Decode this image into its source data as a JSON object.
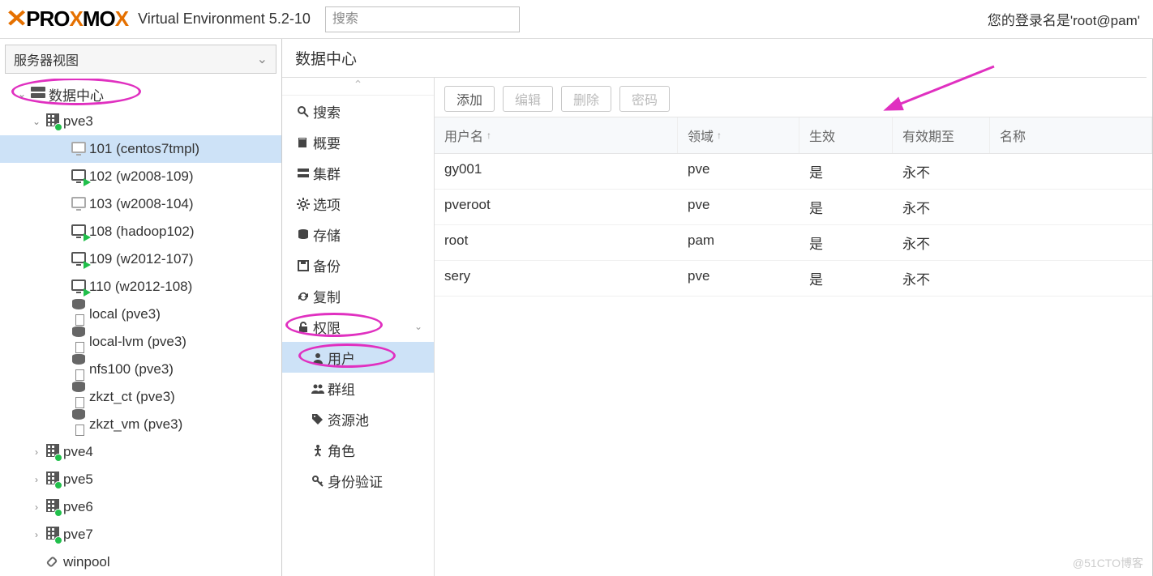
{
  "header": {
    "logo_text": "PROXMOX",
    "env_text": "Virtual Environment 5.2-10",
    "search_placeholder": "搜索",
    "login_text": "您的登录名是'root@pam'"
  },
  "tree": {
    "view_label": "服务器视图",
    "root": "数据中心",
    "nodes": [
      {
        "name": "pve3",
        "type": "node",
        "expanded": true,
        "children": [
          {
            "id": "101",
            "name": "101 (centos7tmpl)",
            "type": "vm",
            "running": false,
            "selected": true
          },
          {
            "id": "102",
            "name": "102 (w2008-109)",
            "type": "vm",
            "running": true
          },
          {
            "id": "103",
            "name": "103 (w2008-104)",
            "type": "vm",
            "running": false
          },
          {
            "id": "108",
            "name": "108 (hadoop102)",
            "type": "vm",
            "running": true
          },
          {
            "id": "109",
            "name": "109 (w2012-107)",
            "type": "vm",
            "running": true
          },
          {
            "id": "110",
            "name": "110 (w2012-108)",
            "type": "vm",
            "running": true
          },
          {
            "name": "local (pve3)",
            "type": "storage"
          },
          {
            "name": "local-lvm (pve3)",
            "type": "storage"
          },
          {
            "name": "nfs100 (pve3)",
            "type": "storage"
          },
          {
            "name": "zkzt_ct (pve3)",
            "type": "storage"
          },
          {
            "name": "zkzt_vm (pve3)",
            "type": "storage"
          }
        ]
      },
      {
        "name": "pve4",
        "type": "node",
        "expanded": false
      },
      {
        "name": "pve5",
        "type": "node",
        "expanded": false
      },
      {
        "name": "pve6",
        "type": "node",
        "expanded": false
      },
      {
        "name": "pve7",
        "type": "node",
        "expanded": false
      },
      {
        "name": "winpool",
        "type": "pool"
      }
    ]
  },
  "breadcrumb": "数据中心",
  "menu": {
    "items": [
      {
        "icon": "search",
        "label": "搜索"
      },
      {
        "icon": "book",
        "label": "概要"
      },
      {
        "icon": "server",
        "label": "集群"
      },
      {
        "icon": "gear",
        "label": "选项"
      },
      {
        "icon": "db",
        "label": "存储"
      },
      {
        "icon": "save",
        "label": "备份"
      },
      {
        "icon": "repeat",
        "label": "复制"
      },
      {
        "icon": "unlock",
        "label": "权限",
        "expandable": true,
        "annot": true
      },
      {
        "icon": "user",
        "label": "用户",
        "sub": true,
        "selected": true,
        "annot": true
      },
      {
        "icon": "users",
        "label": "群组",
        "sub": true
      },
      {
        "icon": "tags",
        "label": "资源池",
        "sub": true
      },
      {
        "icon": "person",
        "label": "角色",
        "sub": true
      },
      {
        "icon": "key",
        "label": "身份验证",
        "sub": true
      }
    ]
  },
  "toolbar": {
    "add": "添加",
    "edit": "编辑",
    "remove": "删除",
    "password": "密码"
  },
  "grid": {
    "columns": {
      "user": "用户名",
      "realm": "领域",
      "active": "生效",
      "until": "有效期至",
      "name": "名称"
    },
    "rows": [
      {
        "user": "gy001",
        "realm": "pve",
        "active": "是",
        "until": "永不",
        "name": ""
      },
      {
        "user": "pveroot",
        "realm": "pve",
        "active": "是",
        "until": "永不",
        "name": ""
      },
      {
        "user": "root",
        "realm": "pam",
        "active": "是",
        "until": "永不",
        "name": ""
      },
      {
        "user": "sery",
        "realm": "pve",
        "active": "是",
        "until": "永不",
        "name": ""
      }
    ]
  },
  "watermark": "@51CTO博客"
}
